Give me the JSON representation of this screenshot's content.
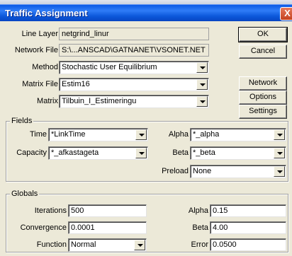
{
  "window": {
    "title": "Traffic Assignment",
    "close_glyph": "X"
  },
  "header": {
    "line_layer_label": "Line Layer",
    "line_layer_value": "netgrind_linur",
    "network_file_label": "Network File",
    "network_file_value": "S:\\...ANSCAD\\GATNANET\\VSONET.NET",
    "method_label": "Method",
    "method_value": "Stochastic User Equilibrium",
    "matrix_file_label": "Matrix File",
    "matrix_file_value": "Estim16",
    "matrix_label": "Matrix",
    "matrix_value": "Tilbuin_I_Estimeringu"
  },
  "buttons": {
    "ok": "OK",
    "cancel": "Cancel",
    "network": "Network",
    "options": "Options",
    "settings": "Settings"
  },
  "fields_group": {
    "title": "Fields",
    "time_label": "Time",
    "time_value": "*LinkTime",
    "capacity_label": "Capacity",
    "capacity_value": "*_afkastageta",
    "alpha_label": "Alpha",
    "alpha_value": "*_alpha",
    "beta_label": "Beta",
    "beta_value": "*_beta",
    "preload_label": "Preload",
    "preload_value": "None"
  },
  "globals_group": {
    "title": "Globals",
    "iterations_label": "Iterations",
    "iterations_value": "500",
    "convergence_label": "Convergence",
    "convergence_value": "0.0001",
    "function_label": "Function",
    "function_value": "Normal",
    "alpha_label": "Alpha",
    "alpha_value": "0.15",
    "beta_label": "Beta",
    "beta_value": "4.00",
    "error_label": "Error",
    "error_value": "0.0500"
  }
}
